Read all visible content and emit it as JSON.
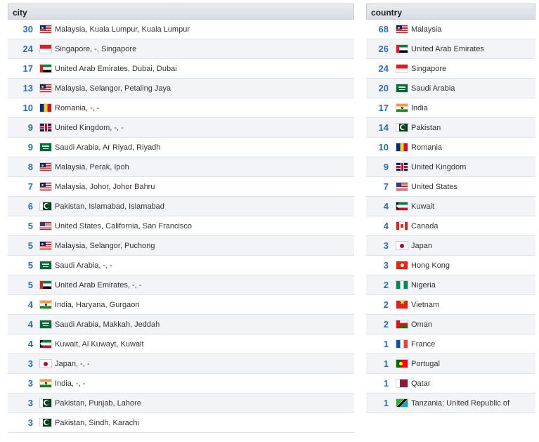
{
  "city": {
    "header": "city",
    "rows": [
      {
        "count": "30",
        "flag": "my",
        "label": "Malaysia, Kuala Lumpur, Kuala Lumpur"
      },
      {
        "count": "24",
        "flag": "sg",
        "label": "Singapore, -, Singapore"
      },
      {
        "count": "17",
        "flag": "ae",
        "label": "United Arab Emirates, Dubai, Dubai"
      },
      {
        "count": "13",
        "flag": "my",
        "label": "Malaysia, Selangor, Petaling Jaya"
      },
      {
        "count": "10",
        "flag": "ro",
        "label": "Romania, -, -"
      },
      {
        "count": "9",
        "flag": "gb",
        "label": "United Kingdom, -, -"
      },
      {
        "count": "9",
        "flag": "sa",
        "label": "Saudi Arabia, Ar Riyad, Riyadh"
      },
      {
        "count": "8",
        "flag": "my",
        "label": "Malaysia, Perak, Ipoh"
      },
      {
        "count": "7",
        "flag": "my",
        "label": "Malaysia, Johor, Johor Bahru"
      },
      {
        "count": "6",
        "flag": "pk",
        "label": "Pakistan, Islamabad, Islamabad"
      },
      {
        "count": "5",
        "flag": "us",
        "label": "United States, California, San Francisco"
      },
      {
        "count": "5",
        "flag": "my",
        "label": "Malaysia, Selangor, Puchong"
      },
      {
        "count": "5",
        "flag": "sa",
        "label": "Saudi Arabia, -, -"
      },
      {
        "count": "5",
        "flag": "ae",
        "label": "United Arab Emirates, -, -"
      },
      {
        "count": "4",
        "flag": "in",
        "label": "India, Haryana, Gurgaon"
      },
      {
        "count": "4",
        "flag": "sa",
        "label": "Saudi Arabia, Makkah, Jeddah"
      },
      {
        "count": "4",
        "flag": "kw",
        "label": "Kuwait, Al Kuwayt, Kuwait"
      },
      {
        "count": "3",
        "flag": "jp",
        "label": "Japan, -, -"
      },
      {
        "count": "3",
        "flag": "in",
        "label": "India, -, -"
      },
      {
        "count": "3",
        "flag": "pk",
        "label": "Pakistan, Punjab, Lahore"
      },
      {
        "count": "3",
        "flag": "pk",
        "label": "Pakistan, Sindh, Karachi"
      }
    ]
  },
  "country": {
    "header": "country",
    "rows": [
      {
        "count": "68",
        "flag": "my",
        "label": "Malaysia"
      },
      {
        "count": "26",
        "flag": "ae",
        "label": "United Arab Emirates"
      },
      {
        "count": "24",
        "flag": "sg",
        "label": "Singapore"
      },
      {
        "count": "20",
        "flag": "sa",
        "label": "Saudi Arabia"
      },
      {
        "count": "17",
        "flag": "in",
        "label": "India"
      },
      {
        "count": "14",
        "flag": "pk",
        "label": "Pakistan"
      },
      {
        "count": "10",
        "flag": "ro",
        "label": "Romania"
      },
      {
        "count": "9",
        "flag": "gb",
        "label": "United Kingdom"
      },
      {
        "count": "7",
        "flag": "us",
        "label": "United States"
      },
      {
        "count": "4",
        "flag": "kw",
        "label": "Kuwait"
      },
      {
        "count": "4",
        "flag": "ca",
        "label": "Canada"
      },
      {
        "count": "3",
        "flag": "jp",
        "label": "Japan"
      },
      {
        "count": "3",
        "flag": "hk",
        "label": "Hong Kong"
      },
      {
        "count": "2",
        "flag": "ng",
        "label": "Nigeria"
      },
      {
        "count": "2",
        "flag": "vn",
        "label": "Vietnam"
      },
      {
        "count": "2",
        "flag": "om",
        "label": "Oman"
      },
      {
        "count": "1",
        "flag": "fr",
        "label": "France"
      },
      {
        "count": "1",
        "flag": "pt",
        "label": "Portugal"
      },
      {
        "count": "1",
        "flag": "qa",
        "label": "Qatar"
      },
      {
        "count": "1",
        "flag": "tz",
        "label": "Tanzania; United Republic of"
      }
    ]
  }
}
